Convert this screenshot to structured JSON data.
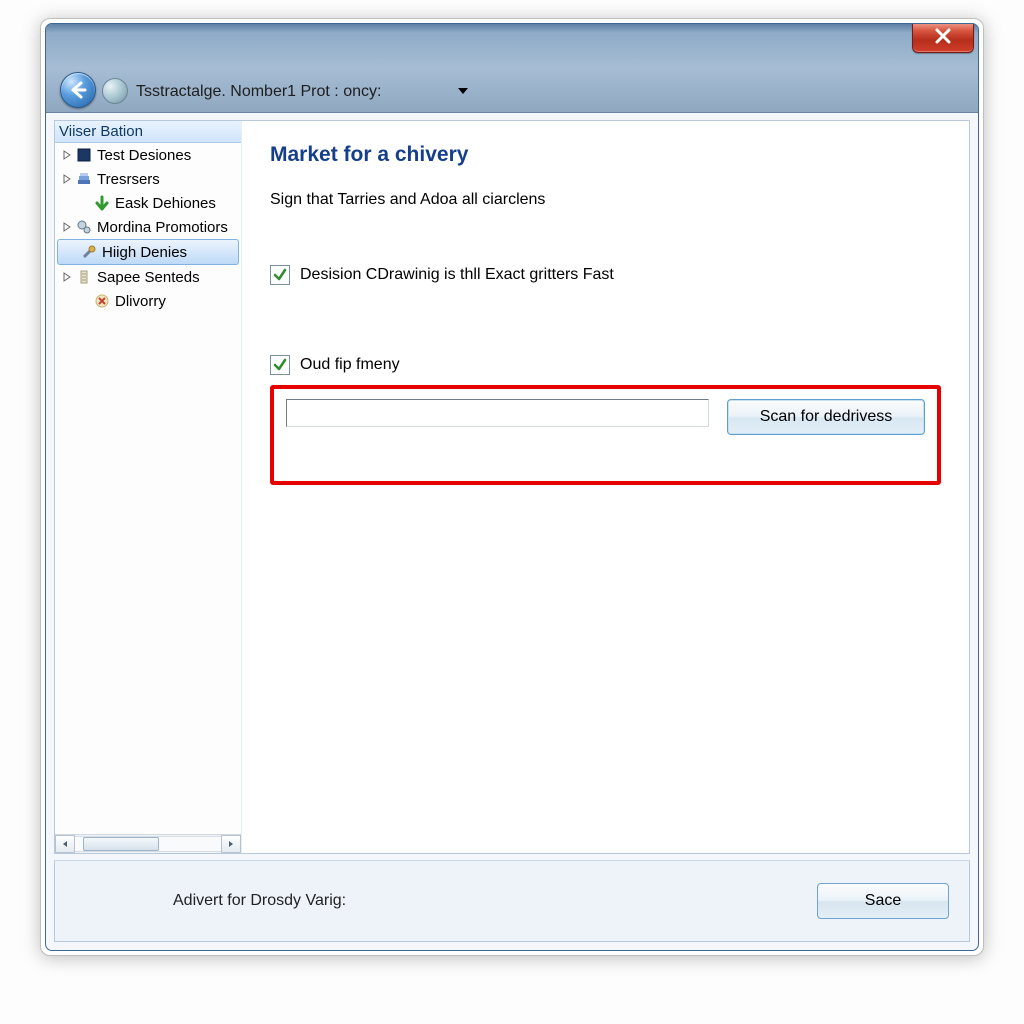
{
  "titlebar": {
    "address": "Tsstractalge. Nomber1 Prot : oncy:"
  },
  "sidebar": {
    "header": "Viiser Bation",
    "items": [
      {
        "label": "Test Desiones",
        "expandable": true,
        "level": 1,
        "icon": "square-icon"
      },
      {
        "label": "Tresrsers",
        "expandable": true,
        "level": 1,
        "icon": "stack-icon"
      },
      {
        "label": "Eask Dehiones",
        "expandable": false,
        "level": 2,
        "icon": "down-arrow-icon"
      },
      {
        "label": "Mordina Promotiors",
        "expandable": true,
        "level": 1,
        "icon": "gears-icon"
      },
      {
        "label": "Hiigh Denies",
        "expandable": false,
        "level": 2,
        "icon": "tools-icon",
        "selected": true
      },
      {
        "label": "Sapee Senteds",
        "expandable": true,
        "level": 1,
        "icon": "column-icon"
      },
      {
        "label": "Dlivorry",
        "expandable": false,
        "level": 2,
        "icon": "cross-icon"
      }
    ]
  },
  "content": {
    "heading": "Market for a chivery",
    "subtext": "Sign that Tarries and Adoa all ciarclens",
    "checkbox1_label": "Desision CDrawinig is thll Exact gritters Fast",
    "checkbox1_checked": true,
    "checkbox2_label": "Oud fip fmeny",
    "checkbox2_checked": true,
    "path_value": "",
    "scan_button": "Scan for dedrivess"
  },
  "footer": {
    "advert_label": "Adivert for Drosdy Varig:",
    "save_button": "Sace"
  }
}
